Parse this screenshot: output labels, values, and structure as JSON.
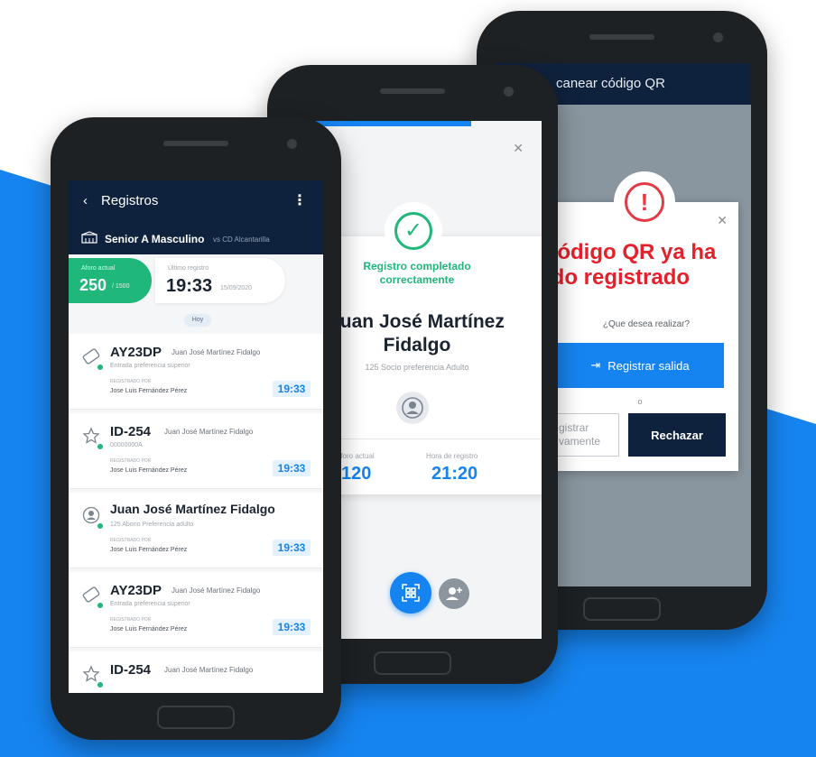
{
  "colors": {
    "brand_blue": "#1684f0",
    "navy": "#0f223d",
    "success_green": "#20b77a",
    "error_red": "#e4202b"
  },
  "phone_qr": {
    "header_title": "canear código QR",
    "alert_icon": "alert-circle-icon",
    "close_icon": "close-icon",
    "title_line1": "código QR ya ha",
    "title_line2": "ido registrado",
    "question": "¿Que desea realizar?",
    "primary_button": "Registrar salida",
    "primary_icon": "exit-icon",
    "separator": "o",
    "secondary_line1": "gistrar",
    "secondary_line2": "vamente",
    "reject_button": "Rechazar"
  },
  "phone_success": {
    "close_icon": "close-icon",
    "check_icon": "check-circle-icon",
    "success_line1": "Registro completado",
    "success_line2": "correctamente",
    "name_line1": "Juan José Martínez",
    "name_line2": "Fidalgo",
    "subtitle": "125 Socio preferencia Adulto",
    "user_icon": "user-icon",
    "aforo_label": "Aforo actual",
    "aforo_value": "120",
    "hora_label": "Hora de registro",
    "hora_value": "21:20",
    "qr_button_icon": "qr-scan-icon",
    "add_user_icon": "add-user-icon"
  },
  "phone_registros": {
    "back_icon": "chevron-left-icon",
    "title": "Registros",
    "menu_icon": "more-vertical-icon",
    "stadium_icon": "stadium-icon",
    "team": "Senior A Masculino",
    "rival": "vs CD Alcantarilla",
    "aforo_label": "Aforo actual",
    "aforo_value": "250",
    "aforo_total": "/ 1500",
    "ultimo_label": "Último registro",
    "ultimo_time": "19:33",
    "ultimo_date": "15/09/2020",
    "day_chip": "Hoy",
    "items": [
      {
        "icon": "ticket-icon",
        "code": "AY23DP",
        "name": "Juan José Martínez Fidalgo",
        "sub": "Entrada preferencia superior",
        "reg_label": "REGISTRADO POR",
        "reg_name": "Jose Luis Fernández Pérez",
        "time": "19:33"
      },
      {
        "icon": "star-icon",
        "code": "ID-254",
        "name": "Juan José Martínez Fidalgo",
        "sub": "00000000A",
        "reg_label": "REGISTRADO POR",
        "reg_name": "Jose Luis Fernández Pérez",
        "time": "19:33"
      },
      {
        "icon": "user-icon",
        "code": "Juan José Martínez Fidalgo",
        "name": "",
        "sub": "125 Abono Preferencia adulto",
        "reg_label": "REGISTRADO POR",
        "reg_name": "Jose Luis Fernández Pérez",
        "time": "19:33"
      },
      {
        "icon": "ticket-icon",
        "code": "AY23DP",
        "name": "Juan José Martínez Fidalgo",
        "sub": "Entrada preferencia superior",
        "reg_label": "REGISTRADO POR",
        "reg_name": "Jose Luis Fernández Pérez",
        "time": "19:33"
      },
      {
        "icon": "star-icon",
        "code": "ID-254",
        "name": "Juan José Martínez Fidalgo",
        "sub": "",
        "reg_label": "",
        "reg_name": "",
        "time": ""
      }
    ]
  }
}
